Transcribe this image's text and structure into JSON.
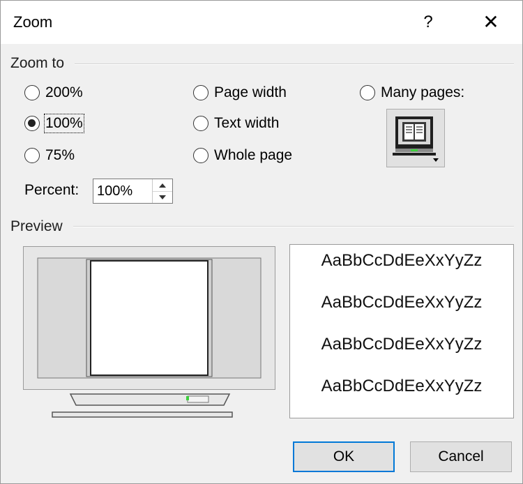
{
  "dialog": {
    "title": "Zoom",
    "help_label": "?",
    "close_label": "✕"
  },
  "zoom_to": {
    "group_label": "Zoom to",
    "options": [
      {
        "label": "200%",
        "checked": false
      },
      {
        "label": "100%",
        "checked": true
      },
      {
        "label": "75%",
        "checked": false
      },
      {
        "label": "Page width",
        "checked": false
      },
      {
        "label": "Text width",
        "checked": false
      },
      {
        "label": "Whole page",
        "checked": false
      },
      {
        "label": "Many pages:",
        "checked": false
      }
    ],
    "percent_label": "Percent:",
    "percent_value": "100%",
    "many_pages_icon": "monitor-pages-icon"
  },
  "preview": {
    "group_label": "Preview",
    "sample_lines": [
      "AaBbCcDdEeXxYyZz",
      "AaBbCcDdEeXxYyZz",
      "AaBbCcDdEeXxYyZz",
      "AaBbCcDdEeXxYyZz"
    ]
  },
  "buttons": {
    "ok_label": "OK",
    "cancel_label": "Cancel"
  },
  "colors": {
    "dialog_bg": "#f0f0f0",
    "title_bg": "#ffffff",
    "focus_accent": "#0078d7"
  }
}
